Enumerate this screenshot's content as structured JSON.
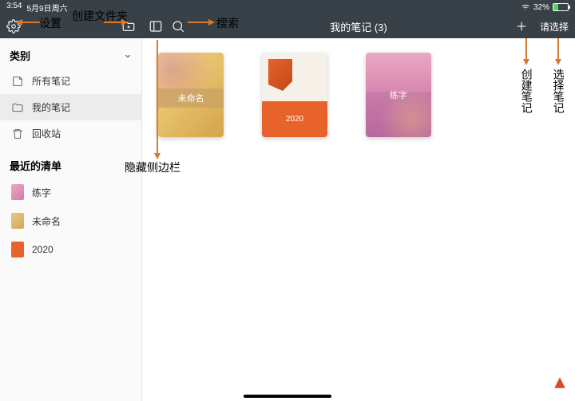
{
  "status": {
    "time": "3:54",
    "date": "5月9日周六",
    "battery_pct": "32%"
  },
  "toolbar": {
    "title": "我的笔记 (3)",
    "select": "请选择"
  },
  "sidebar": {
    "section_categories": "类别",
    "section_recent": "最近的清单",
    "items": [
      {
        "label": "所有笔记"
      },
      {
        "label": "我的笔记"
      },
      {
        "label": "回收站"
      }
    ],
    "recent": [
      {
        "label": "练字"
      },
      {
        "label": "未命名"
      },
      {
        "label": "2020"
      }
    ]
  },
  "notes": [
    {
      "title": "未命名"
    },
    {
      "title": "2020"
    },
    {
      "title": "练字"
    }
  ],
  "annotations": {
    "settings": "设置",
    "create_folder": "创建文件夹",
    "search": "搜索",
    "hide_sidebar": "隐藏侧边栏",
    "create_note": "创建笔记",
    "select_note": "选择笔记"
  }
}
